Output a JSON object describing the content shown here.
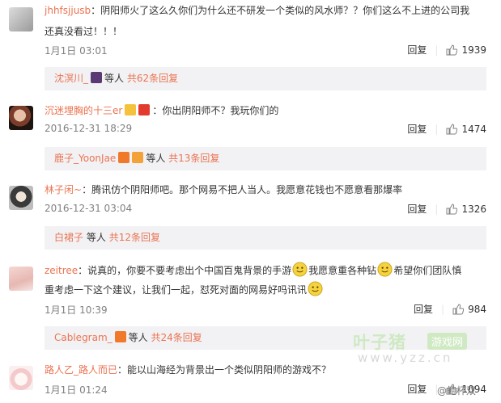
{
  "comments": [
    {
      "author": "jhhfsjjusb",
      "text_line1": "：阴阳师火了这么久你们为什么还不研发一个类似的风水师？？你们这么不上进的公司我",
      "text_line2": "还真没看过！！！",
      "time": "1月1日 03:01",
      "reply_label": "回复",
      "likes": "1939",
      "sub": {
        "user": "沈溟川_",
        "mid": "等人",
        "count": "共62条回复"
      }
    },
    {
      "author": "沉迷埋胸的十三er",
      "text": "：你出阴阳师不？我玩你们的",
      "time": "2016-12-31 18:29",
      "reply_label": "回复",
      "likes": "1474",
      "sub": {
        "user": "鹿子_YoonJae",
        "mid": "等人",
        "count": "共13条回复"
      }
    },
    {
      "author": "林子闲~",
      "text": "：腾讯仿个阴阳师吧。那个网易不把人当人。我愿意花钱也不愿意看那爆率",
      "time": "2016-12-31 03:04",
      "reply_label": "回复",
      "likes": "1326",
      "sub": {
        "user": "白裙子",
        "mid": "等人",
        "count": "共12条回复"
      }
    },
    {
      "author": "zeitree",
      "text_p1": "：说真的，你要不要考虑出个中国百鬼背景的手游",
      "text_p2": "我愿意重各种钻",
      "text_p3": "希望你们团队慎",
      "text_line2": "重考虑一下这个建议，让我们一起，怼死对面的网易好吗讯讯",
      "time": "1月1日 10:39",
      "reply_label": "回复",
      "likes": "984",
      "sub": {
        "user": "Cablegram_",
        "mid": "等人",
        "count": "共24条回复"
      }
    },
    {
      "author": "路人乙_路人而已",
      "text": "：能以山海经为背景出一个类似阴阳师的游戏不？",
      "time": "1月1日 01:24",
      "reply_label": "回复",
      "likes": "1094"
    }
  ],
  "watermark": {
    "main": "叶子猪",
    "tag": "游戏网",
    "url": "www.yzz.cn",
    "corner": "@鲍杯双"
  },
  "colors": {
    "author": "#eb7350",
    "meta": "#808080",
    "subbar_bg": "#f2f2f5"
  },
  "icons": [
    "thumbs-up-icon",
    "smiley-icon",
    "badge-icon"
  ]
}
